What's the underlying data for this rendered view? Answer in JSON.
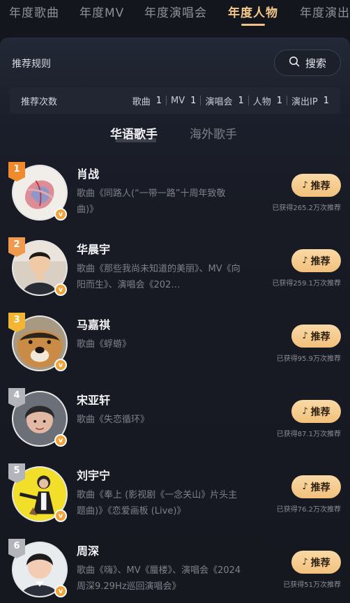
{
  "top_tabs": [
    "年度歌曲",
    "年度MV",
    "年度演唱会",
    "年度人物",
    "年度演出"
  ],
  "active_top_tab": "年度人物",
  "rule_link": "推荐规则",
  "search_label": "搜索",
  "counts": {
    "title": "推荐次数",
    "items": [
      {
        "label": "歌曲",
        "value": "1"
      },
      {
        "label": "MV",
        "value": "1"
      },
      {
        "label": "演唱会",
        "value": "1"
      },
      {
        "label": "人物",
        "value": "1"
      },
      {
        "label": "演出IP",
        "value": "1"
      }
    ]
  },
  "sub_tabs": {
    "active": "华语歌手",
    "inactive": "海外歌手"
  },
  "recommend_label": "推荐",
  "verified_badge": "v",
  "artists": [
    {
      "rank": "1",
      "name": "肖战",
      "works": "歌曲《同路人(“一带一路”十周年致敬曲)》",
      "gained": "已获得265.2万次推荐",
      "rank_color": "#f08a2c"
    },
    {
      "rank": "2",
      "name": "华晨宇",
      "works": "歌曲《那些我尚未知道的美丽》、MV《向阳而生》、演唱会《202…",
      "gained": "已获得259.1万次推荐",
      "rank_color": "#f09a50"
    },
    {
      "rank": "3",
      "name": "马嘉祺",
      "works": "歌曲《蜉蝣》",
      "gained": "已获得95.9万次推荐",
      "rank_color": "#f2b634"
    },
    {
      "rank": "4",
      "name": "宋亚轩",
      "works": "歌曲《失恋循环》",
      "gained": "已获得87.1万次推荐",
      "rank_color": "#b3b5bb"
    },
    {
      "rank": "5",
      "name": "刘宇宁",
      "works": "歌曲《奉上 (影视剧《一念关山》片头主题曲)》《恋爱画板 (Live)》",
      "gained": "已获得76.2万次推荐",
      "rank_color": "#b3b5bb"
    },
    {
      "rank": "6",
      "name": "周深",
      "works": "歌曲《嗨》、MV《蜃楼》、演唱会《2024周深9.29Hz巡回演唱会》",
      "gained": "已获得51万次推荐",
      "rank_color": "#b3b5bb"
    }
  ]
}
